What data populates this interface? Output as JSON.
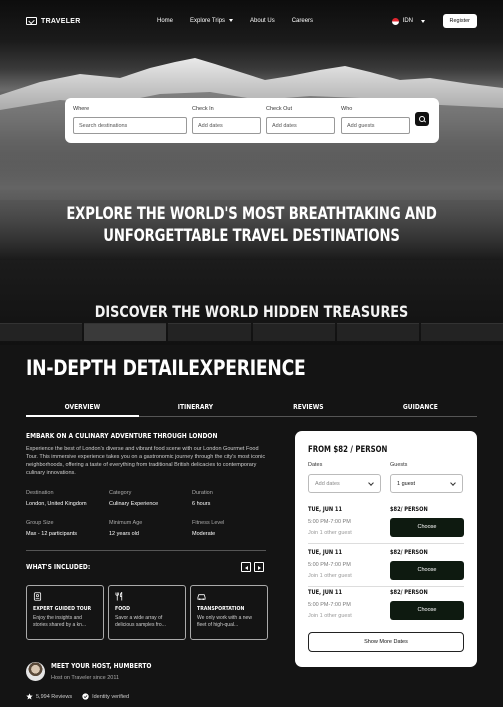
{
  "nav": {
    "brand": "TRAVELER",
    "items": [
      {
        "label": "Home"
      },
      {
        "label": "Explore Trips"
      },
      {
        "label": "About Us"
      },
      {
        "label": "Careers"
      }
    ],
    "language": "IDN",
    "register": "Register"
  },
  "search": {
    "where": {
      "label": "Where",
      "placeholder": "Search destinations"
    },
    "check_in": {
      "label": "Check In",
      "placeholder": "Add dates"
    },
    "check_out": {
      "label": "Check Out",
      "placeholder": "Add dates"
    },
    "who": {
      "label": "Who",
      "placeholder": "Add guests"
    }
  },
  "hero": {
    "title_line1": "EXPLORE THE WORLD'S MOST BREATHTAKING AND",
    "title_line2": "UNFORGETTABLE TRAVEL DESTINATIONS",
    "next_section": "DISCOVER THE WORLD HIDDEN TREASURES"
  },
  "detail": {
    "heading": "IN-DEPTH DETAILEXPERIENCE",
    "tabs": [
      "OVERVIEW",
      "ITINERARY",
      "REVIEWS",
      "GUIDANCE"
    ],
    "title": "EMBARK ON A CULINARY ADVENTURE THROUGH LONDON",
    "description": "Experience the best of London's diverse and vibrant food scene with our London Gourmet Food Tour. This immersive experience takes you on a gastronomic journey through the city's most iconic neighborhoods, offering a taste of everything from traditional British delicacies to contemporary culinary innovations.",
    "facts": {
      "destination": {
        "label": "Destination",
        "value": "London, United Kingdom"
      },
      "category": {
        "label": "Category",
        "value": "Culinary Experience"
      },
      "duration": {
        "label": "Duration",
        "value": "6 hours"
      },
      "group_size": {
        "label": "Group Size",
        "value": "Max - 12 participants"
      },
      "minimum_age": {
        "label": "Minimum Age",
        "value": "12 years old"
      },
      "fitness_level": {
        "label": "Fitness Level",
        "value": "Moderate"
      }
    },
    "included_heading": "WHAT'S INCLUDED:",
    "included": [
      {
        "icon": "id-badge-icon",
        "title": "EXPERT GUIDED TOUR",
        "text": "Enjoy the insights and stories shared by a kn..."
      },
      {
        "icon": "cutlery-icon",
        "title": "FOOD",
        "text": "Savor a wide array of delicious samples fro..."
      },
      {
        "icon": "car-icon",
        "title": "TRANSPORTATION",
        "text": "We only work with a new fleet of high-qual..."
      }
    ],
    "host": {
      "name": "MEET YOUR HOST, HUMBERTO",
      "since": "Host on Traveler since 2011",
      "reviews": "5,994 Reviews",
      "verified": "Identity verified"
    }
  },
  "booking": {
    "price": "FROM $82 / PERSON",
    "dates_label": "Dates",
    "dates_placeholder": "Add dates",
    "guests_label": "Guests",
    "guests_value": "1 guest",
    "slots": [
      {
        "date": "TUE, JUN 11",
        "time": "5:00 PM-7:00 PM",
        "join": "Join 1 other guest",
        "price": "$82/ PERSON",
        "button": "Choose"
      },
      {
        "date": "TUE, JUN 11",
        "time": "5:00 PM-7:00 PM",
        "join": "Join 1 other guest",
        "price": "$82/ PERSON",
        "button": "Choose"
      },
      {
        "date": "TUE, JUN 11",
        "time": "5:00 PM-7:00 PM",
        "join": "Join 1 other guest",
        "price": "$82/ PERSON",
        "button": "Choose"
      }
    ],
    "more": "Show More Dates"
  }
}
